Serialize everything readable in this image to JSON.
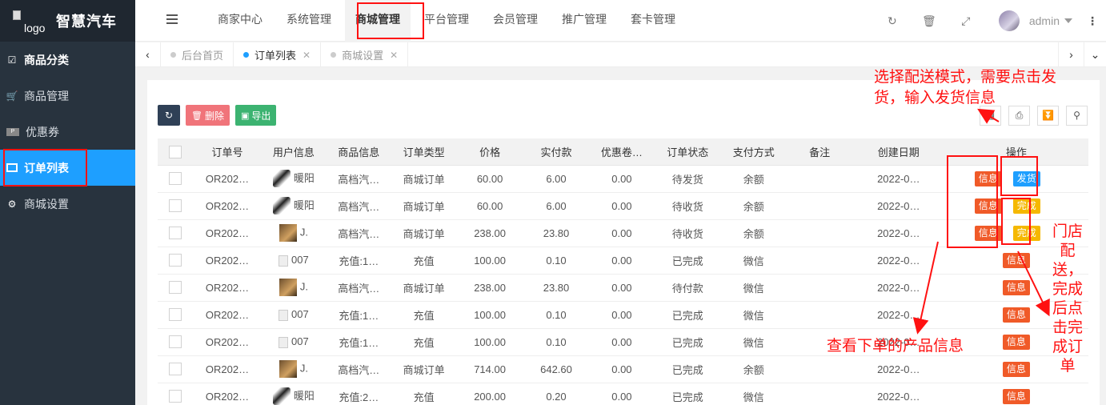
{
  "sidebar": {
    "logo_alt": "logo",
    "title": "智慧汽车",
    "items": [
      {
        "label": "商品分类",
        "icon": "calendar-check-icon"
      },
      {
        "label": "商品管理",
        "icon": "cart-icon"
      },
      {
        "label": "优惠券",
        "icon": "paypal-icon"
      },
      {
        "label": "订单列表",
        "icon": "credit-card-icon"
      },
      {
        "label": "商城设置",
        "icon": "gears-icon"
      }
    ]
  },
  "header": {
    "nav": [
      "商家中心",
      "系统管理",
      "商城管理",
      "平台管理",
      "会员管理",
      "推广管理",
      "套卡管理"
    ],
    "username": "admin"
  },
  "tabs": [
    {
      "label": "后台首页"
    },
    {
      "label": "订单列表"
    },
    {
      "label": "商城设置"
    }
  ],
  "toolbar": {
    "delete_label": "删除",
    "export_label": "导出"
  },
  "table": {
    "columns": [
      "订单号",
      "用户信息",
      "商品信息",
      "订单类型",
      "价格",
      "实付款",
      "优惠卷…",
      "订单状态",
      "支付方式",
      "备注",
      "创建日期",
      "操作"
    ],
    "rows": [
      {
        "order": "OR202…",
        "user": "暖阳",
        "product": "高档汽…",
        "type": "商城订单",
        "price": "60.00",
        "paid": "6.00",
        "coupon": "0.00",
        "status": "待发货",
        "pay": "余额",
        "date": "2022-0…"
      },
      {
        "order": "OR202…",
        "user": "暖阳",
        "product": "高档汽…",
        "type": "商城订单",
        "price": "60.00",
        "paid": "6.00",
        "coupon": "0.00",
        "status": "待收货",
        "pay": "余额",
        "date": "2022-0…"
      },
      {
        "order": "OR202…",
        "user": "J.",
        "product": "高档汽…",
        "type": "商城订单",
        "price": "238.00",
        "paid": "23.80",
        "coupon": "0.00",
        "status": "待收货",
        "pay": "余额",
        "date": "2022-0…"
      },
      {
        "order": "OR202…",
        "user": "007",
        "product": "充值:1…",
        "type": "充值",
        "price": "100.00",
        "paid": "0.10",
        "coupon": "0.00",
        "status": "已完成",
        "pay": "微信",
        "date": "2022-0…"
      },
      {
        "order": "OR202…",
        "user": "J.",
        "product": "高档汽…",
        "type": "商城订单",
        "price": "238.00",
        "paid": "23.80",
        "coupon": "0.00",
        "status": "待付款",
        "pay": "微信",
        "date": "2022-0…"
      },
      {
        "order": "OR202…",
        "user": "007",
        "product": "充值:1…",
        "type": "充值",
        "price": "100.00",
        "paid": "0.10",
        "coupon": "0.00",
        "status": "已完成",
        "pay": "微信",
        "date": "2022-0…"
      },
      {
        "order": "OR202…",
        "user": "007",
        "product": "充值:1…",
        "type": "充值",
        "price": "100.00",
        "paid": "0.10",
        "coupon": "0.00",
        "status": "已完成",
        "pay": "微信",
        "date": "2022-0…"
      },
      {
        "order": "OR202…",
        "user": "J.",
        "product": "高档汽…",
        "type": "商城订单",
        "price": "714.00",
        "paid": "642.60",
        "coupon": "0.00",
        "status": "已完成",
        "pay": "余额",
        "date": "2022-0…"
      },
      {
        "order": "OR202…",
        "user": "暖阳",
        "product": "充值:2…",
        "type": "充值",
        "price": "200.00",
        "paid": "0.20",
        "coupon": "0.00",
        "status": "已完成",
        "pay": "微信",
        "date": "2022-0…"
      }
    ],
    "actions": {
      "info": "信息",
      "ship": "发货",
      "complete": "完成"
    }
  },
  "annotations": {
    "ship_note_line1": "选择配送模式，需要点击发",
    "ship_note_line2": "货，输入发货信息",
    "info_note": "查看下单的产品信息",
    "store_note": [
      "门店",
      "配",
      "送，",
      "完成",
      "后点",
      "击完",
      "成订",
      "单"
    ]
  },
  "colors": {
    "annotation": "#ff1111",
    "primary": "#1e9fff",
    "info_tag": "#f05a28",
    "done_tag": "#f5b800"
  }
}
